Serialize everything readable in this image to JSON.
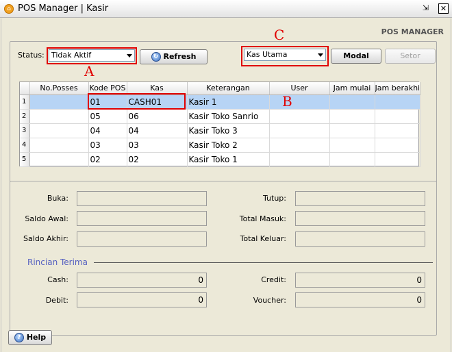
{
  "window": {
    "title": "POS Manager | Kasir",
    "brand": "POS MANAGER"
  },
  "toolbar": {
    "status_label": "Status:",
    "status_value": "Tidak Aktif",
    "refresh_label": "Refresh",
    "kas_value": "Kas Utama",
    "modal_label": "Modal",
    "setor_label": "Setor"
  },
  "annotations": {
    "a": "A",
    "b": "B",
    "c": "C"
  },
  "grid": {
    "columns": [
      "No.Posses",
      "Kode POS",
      "Kas",
      "Keterangan",
      "User",
      "Jam mulai",
      "Jam berakhir"
    ],
    "rows": [
      {
        "num": "1",
        "cells": [
          "",
          "01",
          "CASH01",
          "Kasir 1",
          "",
          "",
          ""
        ]
      },
      {
        "num": "2",
        "cells": [
          "",
          "05",
          "06",
          "Kasir Toko Sanrio",
          "",
          "",
          ""
        ]
      },
      {
        "num": "3",
        "cells": [
          "",
          "04",
          "04",
          "Kasir Toko 3",
          "",
          "",
          ""
        ]
      },
      {
        "num": "4",
        "cells": [
          "",
          "03",
          "03",
          "Kasir Toko 2",
          "",
          "",
          ""
        ]
      },
      {
        "num": "5",
        "cells": [
          "",
          "02",
          "02",
          "Kasir Toko 1",
          "",
          "",
          ""
        ]
      }
    ]
  },
  "details": {
    "buka_label": "Buka:",
    "tutup_label": "Tutup:",
    "saldo_awal_label": "Saldo Awal:",
    "total_masuk_label": "Total Masuk:",
    "saldo_akhir_label": "Saldo Akhir:",
    "total_keluar_label": "Total Keluar:"
  },
  "rincian": {
    "title": "Rincian Terima",
    "cash_label": "Cash:",
    "cash_value": "0",
    "credit_label": "Credit:",
    "credit_value": "0",
    "debit_label": "Debit:",
    "debit_value": "0",
    "voucher_label": "Voucher:",
    "voucher_value": "0"
  },
  "footer": {
    "help_label": "Help"
  }
}
